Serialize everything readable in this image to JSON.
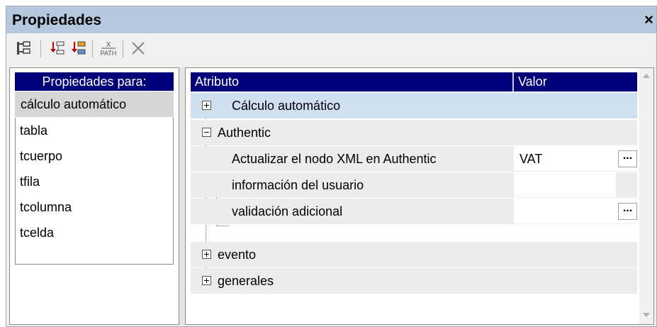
{
  "window": {
    "title": "Propiedades",
    "close": "×"
  },
  "toolbar": {
    "icons": [
      "tree-view-icon",
      "add-property-icon",
      "add-property-group-icon",
      "xpath-icon",
      "delete-icon"
    ],
    "xpath_top": "X",
    "xpath_bottom": "PATH"
  },
  "left": {
    "header": "Propiedades para:",
    "selected": "cálculo automático",
    "items": [
      "tabla",
      "tcuerpo",
      "tfila",
      "tcolumna",
      "tcelda"
    ]
  },
  "right": {
    "headers": {
      "attribute": "Atributo",
      "value": "Valor"
    },
    "rows": [
      {
        "label": "Cálculo automático"
      },
      {
        "label": "Authentic"
      },
      {
        "label": "Actualizar el nodo XML en Authentic",
        "value": "VAT",
        "button": "..."
      },
      {
        "label": "información del usuario"
      },
      {
        "label": "validación adicional",
        "button": "..."
      },
      {
        "label": "evento"
      },
      {
        "label": "generales"
      }
    ]
  },
  "colors": {
    "header_bg": "#00007a",
    "title_bg": "#b4c8de",
    "highlight_row": "#cfe0f0",
    "group_row": "#ececec"
  }
}
